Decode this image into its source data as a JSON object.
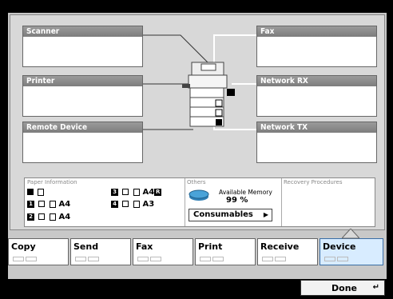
{
  "panels": {
    "scanner": "Scanner",
    "printer": "Printer",
    "remote_device": "Remote Device",
    "fax": "Fax",
    "network_rx": "Network RX",
    "network_tx": "Network TX"
  },
  "paper_info": {
    "title": "Paper Information",
    "a4_trays": [
      {
        "num": "1",
        "size": "A4"
      },
      {
        "num": "2",
        "size": "A4"
      }
    ],
    "right_trays": [
      {
        "num": "3",
        "size": "A4",
        "suffix": "R"
      },
      {
        "num": "4",
        "size": "A3"
      }
    ]
  },
  "others": {
    "title": "Others",
    "memory_label": "Available Memory",
    "memory_value": "99 %",
    "consumables_label": "Consumables"
  },
  "recovery": {
    "title": "Recovery Procedures"
  },
  "tabs": [
    "Copy",
    "Send",
    "Fax",
    "Print",
    "Receive",
    "Device"
  ],
  "active_tab": "Device",
  "done_label": "Done",
  "colors": {
    "header_gray": "#8a8a8a",
    "active_tab": "#d8ecff",
    "memory_icon": "#4aa3d8"
  }
}
